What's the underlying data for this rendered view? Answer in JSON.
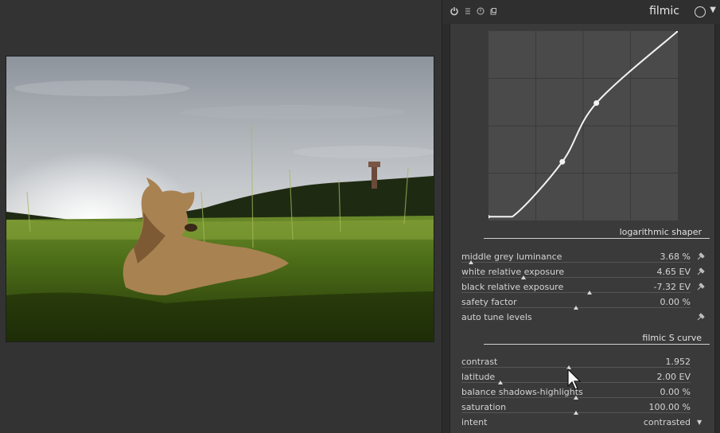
{
  "header": {
    "title": "filmic",
    "icons": [
      "power-icon",
      "presets-icon",
      "reset-icon",
      "duplicate-icon"
    ]
  },
  "curve": {
    "points": [
      [
        0.0,
        0.02
      ],
      [
        0.39,
        0.31
      ],
      [
        0.57,
        0.62
      ],
      [
        1.0,
        1.0
      ]
    ]
  },
  "sections": {
    "log_shaper": "logarithmic shaper",
    "s_curve": "filmic S curve"
  },
  "sliders_log": [
    {
      "label": "middle grey luminance",
      "value": "3.68 %",
      "position": 0.04,
      "picker": true
    },
    {
      "label": "white relative exposure",
      "value": "4.65 EV",
      "position": 0.27,
      "picker": true
    },
    {
      "label": "black relative exposure",
      "value": "-7.32 EV",
      "position": 0.56,
      "picker": true
    },
    {
      "label": "safety factor",
      "value": "0.00 %",
      "position": 0.5,
      "picker": false
    }
  ],
  "auto_tune": {
    "label": "auto tune levels"
  },
  "sliders_s": [
    {
      "label": "contrast",
      "value": "1.952",
      "position": 0.47
    },
    {
      "label": "latitude",
      "value": "2.00 EV",
      "position": 0.17
    },
    {
      "label": "balance shadows-highlights",
      "value": "0.00 %",
      "position": 0.5
    },
    {
      "label": "saturation",
      "value": "100.00 %",
      "position": 0.5
    }
  ],
  "intent": {
    "label": "intent",
    "value": "contrasted"
  },
  "colors": {
    "panel": "#2b2b2b",
    "module": "#3a3a3a",
    "graph": "#4a4a4a",
    "accent": "#d8d8d8"
  }
}
